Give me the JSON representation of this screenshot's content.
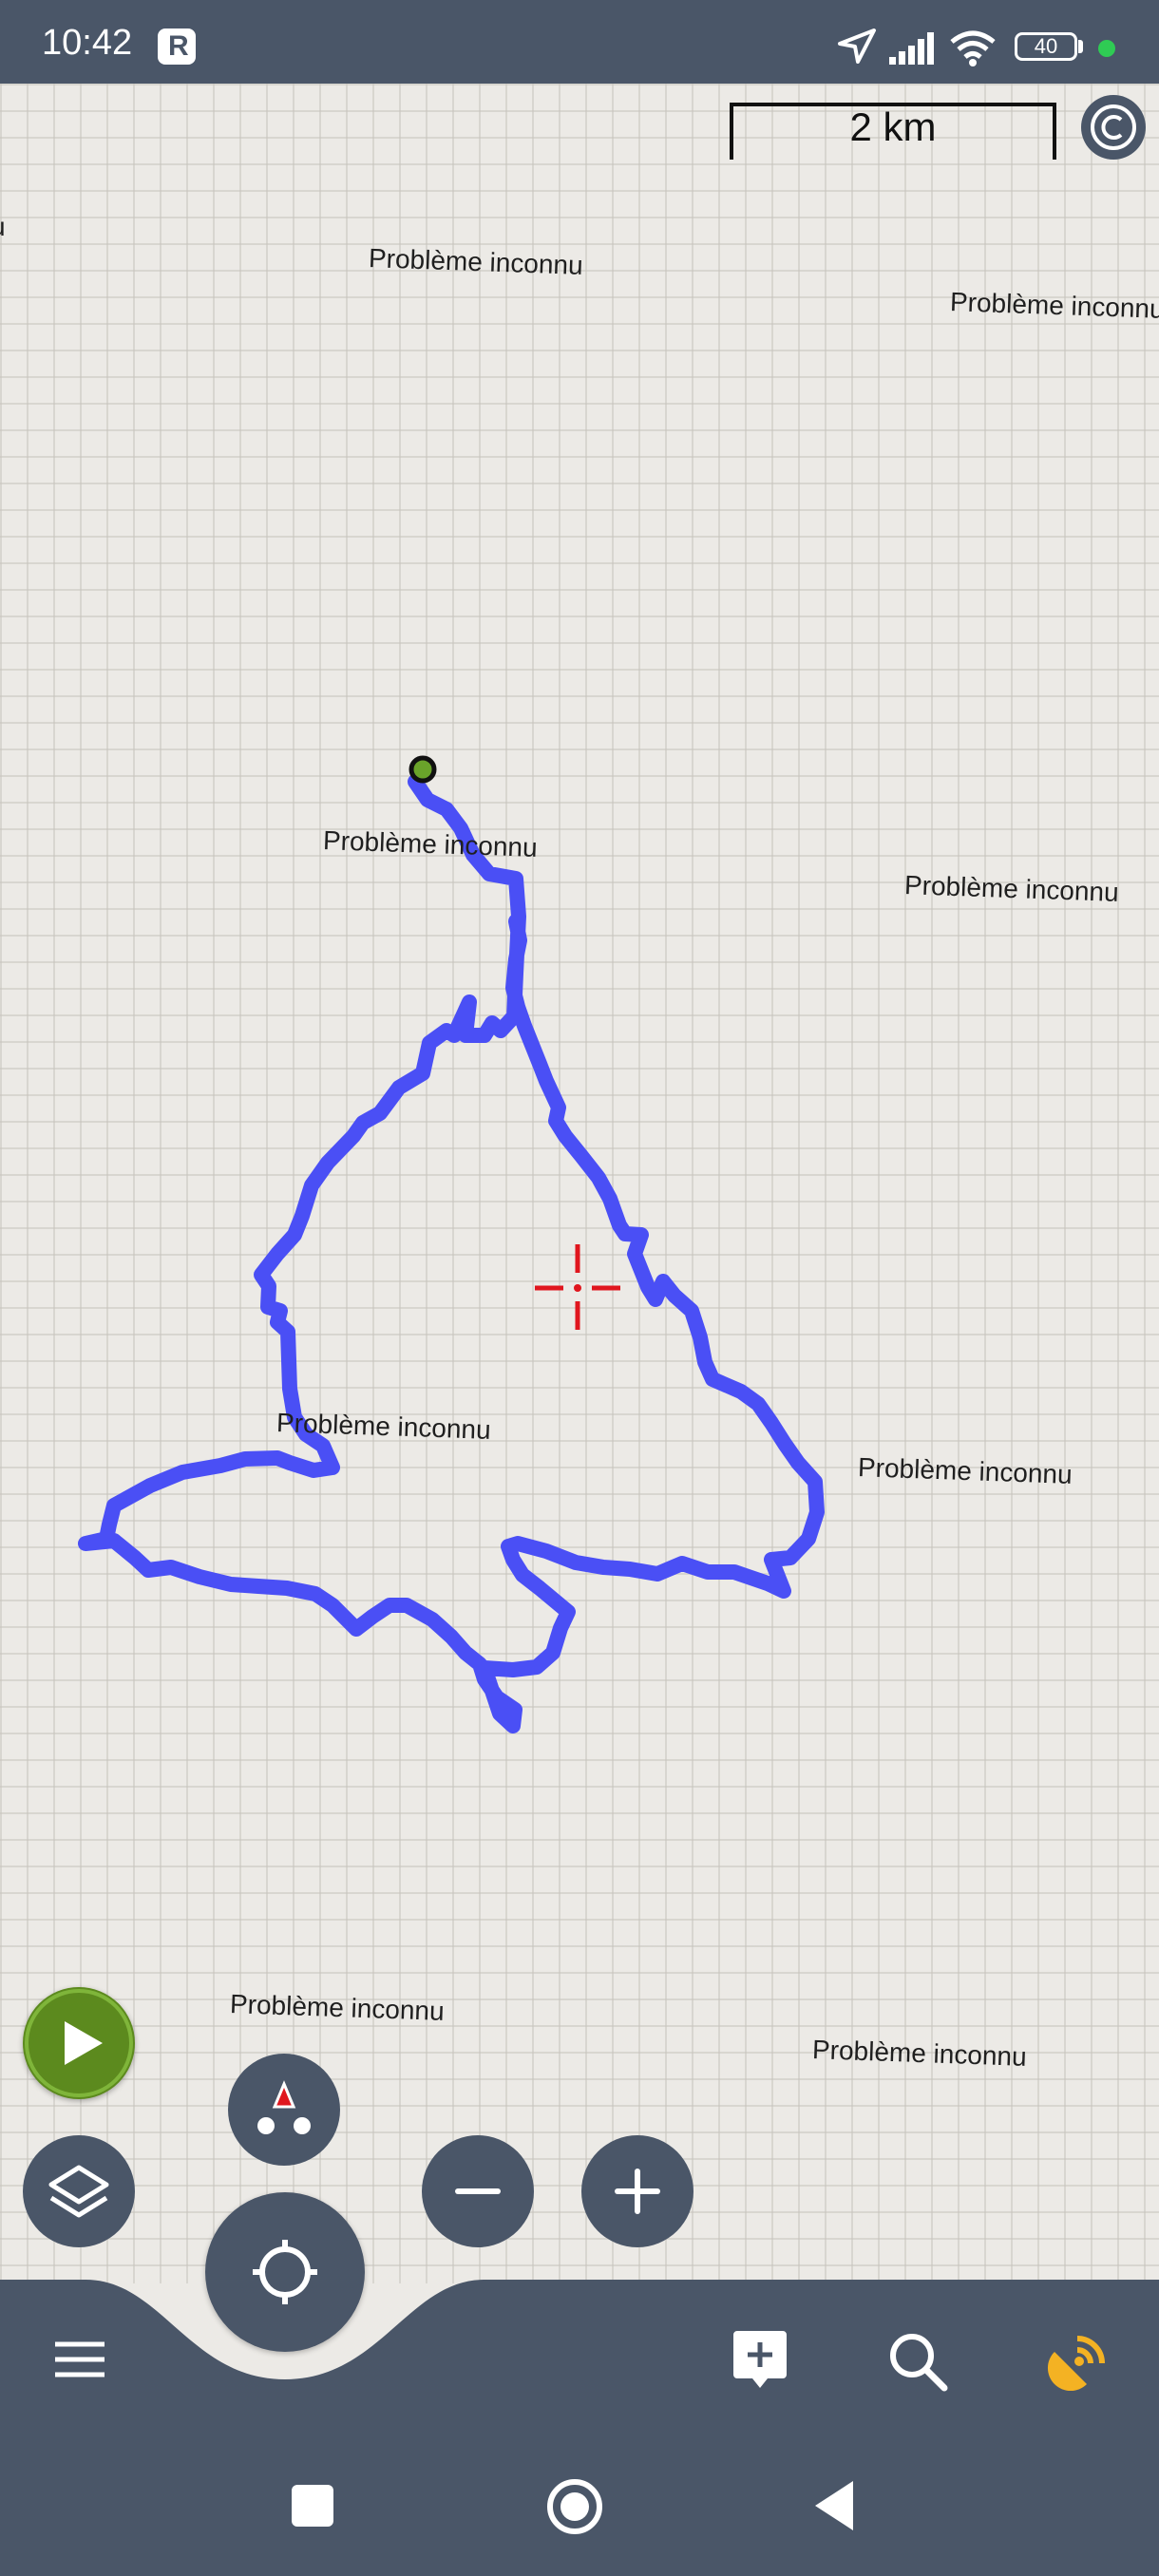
{
  "status_bar": {
    "time": "10:42",
    "battery": "40"
  },
  "map": {
    "scale_label": "2 km",
    "place_labels": [
      "u",
      "Problème inconnu",
      "Problème inconnu",
      "Problème inconnu",
      "Problème inconnu",
      "Problème inconnu",
      "Problème inconnu",
      "Problème inconnu",
      "Problème inconnu"
    ],
    "track_color": "#4A4FF5",
    "crosshair_color": "#E0161E",
    "start_marker_color": "#6AA32A"
  },
  "colors": {
    "toolbar": "#4A5668",
    "play_button": "#5C8A1E",
    "location_accent": "#F4B223"
  },
  "icons": [
    "navigation-arrow-icon",
    "signal-icon",
    "wifi-icon",
    "battery-icon",
    "copyright-icon",
    "play-icon",
    "layers-icon",
    "compass-icon",
    "zoom-out-icon",
    "zoom-in-icon",
    "my-location-icon",
    "menu-icon",
    "add-note-icon",
    "search-icon",
    "gps-signal-icon",
    "recent-apps-icon",
    "home-icon",
    "back-icon"
  ]
}
